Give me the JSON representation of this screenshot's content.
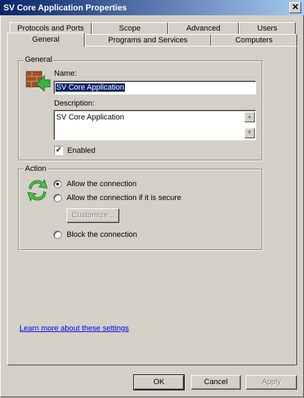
{
  "window": {
    "title": "SV Core Application Properties",
    "close_glyph": "✕"
  },
  "tabs": [
    {
      "label": "Protocols and Ports"
    },
    {
      "label": "Scope"
    },
    {
      "label": "Advanced"
    },
    {
      "label": "Users"
    },
    {
      "label": "General",
      "active": true
    },
    {
      "label": "Programs and Services"
    },
    {
      "label": "Computers"
    }
  ],
  "general_group": {
    "legend": "General",
    "name_label": "Name:",
    "name_value": "SV Core Application",
    "description_label": "Description:",
    "description_value": "SV Core Application",
    "enabled_label": "Enabled",
    "enabled_checked": true,
    "icon": "firewall-brick-icon"
  },
  "action_group": {
    "legend": "Action",
    "icon": "refresh-arrows-icon",
    "options": [
      {
        "label": "Allow the connection",
        "selected": true
      },
      {
        "label": "Allow the connection if it is secure",
        "selected": false
      },
      {
        "label": "Block the connection",
        "selected": false
      }
    ],
    "customize_label": "Customize..."
  },
  "learn_more": "Learn more about these settings",
  "buttons": {
    "ok": "OK",
    "cancel": "Cancel",
    "apply": "Apply"
  },
  "colors": {
    "titlebar": "#0a246a",
    "face": "#d4d0c8",
    "link": "#0000ee",
    "selection": "#0a246a"
  }
}
